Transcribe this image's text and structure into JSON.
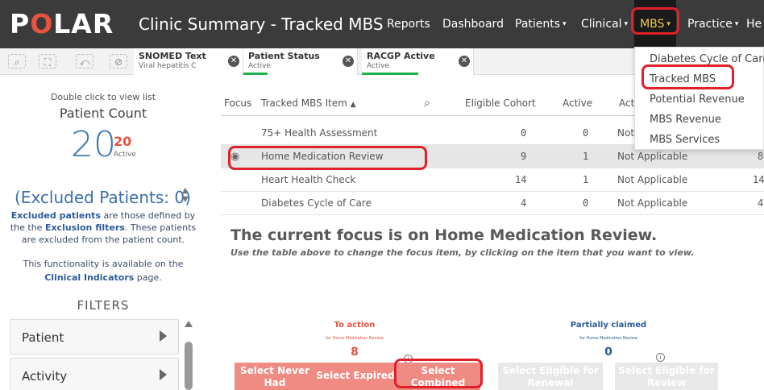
{
  "app": {
    "logo": {
      "p": "P",
      "o": "O",
      "rest": "LAR"
    },
    "title": "Clinic Summary - Tracked MBS"
  },
  "nav": {
    "reports": "Reports",
    "dashboard": "Dashboard",
    "patients": "Patients",
    "clinical": "Clinical",
    "mbs": "MBS",
    "practice": "Practice",
    "help": "He",
    "caret": "▾"
  },
  "selections": [
    {
      "title": "SNOMED Text",
      "sub": "Viral hepatitis C"
    },
    {
      "title": "Patient Status",
      "sub": "Active"
    },
    {
      "title": "RACGP Active",
      "sub": "Active"
    }
  ],
  "left_panel": {
    "dbl_click_hint": "Double click to view list",
    "patient_count_label": "Patient Count",
    "patient_count": "20",
    "active_count": "20",
    "active_label": "Active",
    "excluded_title": "(Excluded Patients: 0)",
    "excluded_desc_1": "Excluded patients",
    "excluded_desc_2": " are those defined by the the ",
    "excluded_desc_3": "Exclusion filters",
    "excluded_desc_4": ". These patients are excluded from the patient count.",
    "func_1": "This functionality is available on the",
    "func_2": "Clinical Indicators",
    "func_3": " page.",
    "filters_heading": "FILTERS",
    "filters": [
      "Patient",
      "Activity"
    ]
  },
  "table": {
    "headers": {
      "focus": "Focus",
      "item": "Tracked MBS Item",
      "sort": "▲",
      "eligible": "Eligible Cohort",
      "active": "Active",
      "act": "Act"
    },
    "rows": [
      {
        "item": "75+ Health Assessment",
        "eligible": "0",
        "active": "0",
        "status": "Not",
        "extra": ""
      },
      {
        "item": "Home Medication Review",
        "eligible": "9",
        "active": "1",
        "status": "Not Applicable",
        "extra": "8",
        "selected": true
      },
      {
        "item": "Heart Health Check",
        "eligible": "14",
        "active": "1",
        "status": "Not Applicable",
        "extra": "14"
      },
      {
        "item": "Diabetes Cycle of Care",
        "eligible": "4",
        "active": "0",
        "status": "Not Applicable",
        "extra": "4"
      }
    ]
  },
  "focus": {
    "heading": "The current focus is on Home Medication Review.",
    "subtext": "Use the table above to change the focus item, by clicking on the item that you want to view."
  },
  "kpis": {
    "to_action": {
      "title": "To action",
      "sub": "for Home Medication Review",
      "value": "8",
      "color": "#e8533f"
    },
    "partially_claimed": {
      "title": "Partially claimed",
      "sub": "for Home Medication Review",
      "value": "0",
      "color": "#2d5b9a"
    },
    "info_glyph": "i"
  },
  "buttons": {
    "never_had": "Select Never Had",
    "expired": "Select Expired",
    "combined": "Select Combined",
    "eligible_renewal": "Select Eligible for Renewal",
    "eligible_review": "Select Eligible for Review"
  },
  "dropdown": {
    "items": [
      "Diabetes Cycle of Care",
      "Tracked MBS",
      "Potential Revenue",
      "MBS Revenue",
      "MBS Services"
    ]
  },
  "colors": {
    "topbar": "#3b3b3b",
    "accent_yellow": "#f4c842",
    "highlight_red": "#e0202a",
    "primary_blue": "#3a7ab5"
  }
}
